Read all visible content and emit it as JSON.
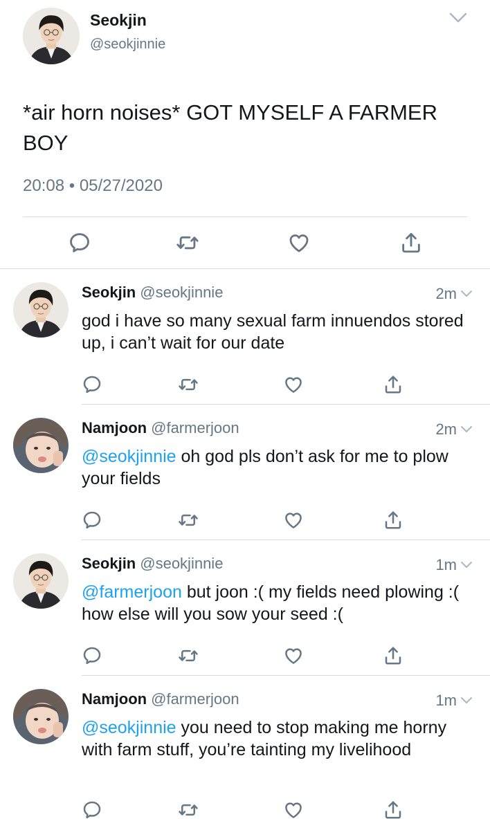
{
  "main_tweet": {
    "author_name": "Seokjin",
    "author_handle": "@seokjinnie",
    "text": "*air horn noises* GOT MYSELF A FARMER BOY",
    "time": "20:08",
    "separator": "•",
    "date": "05/27/2020"
  },
  "replies": [
    {
      "author_name": "Seokjin",
      "author_handle": "@seokjinnie",
      "time_ago": "2m",
      "mention": "",
      "text": "god i have so many sexual farm innuendos stored up, i can’t wait for our date"
    },
    {
      "author_name": "Namjoon",
      "author_handle": "@farmerjoon",
      "time_ago": "2m",
      "mention": "@seokjinnie",
      "text": " oh god pls don’t ask for me to plow your fields"
    },
    {
      "author_name": "Seokjin",
      "author_handle": "@seokjinnie",
      "time_ago": "1m",
      "mention": "@farmerjoon",
      "text": " but joon :( my fields need plowing :( how else will you sow your seed :("
    },
    {
      "author_name": "Namjoon",
      "author_handle": "@farmerjoon",
      "time_ago": "1m",
      "mention": "@seokjinnie",
      "text": " you need to stop making me horny with farm stuff, you’re tainting my livelihood"
    }
  ],
  "colors": {
    "text": "#14171a",
    "secondary": "#657786",
    "link": "#1da1f2",
    "divider": "#d6dbe0"
  }
}
